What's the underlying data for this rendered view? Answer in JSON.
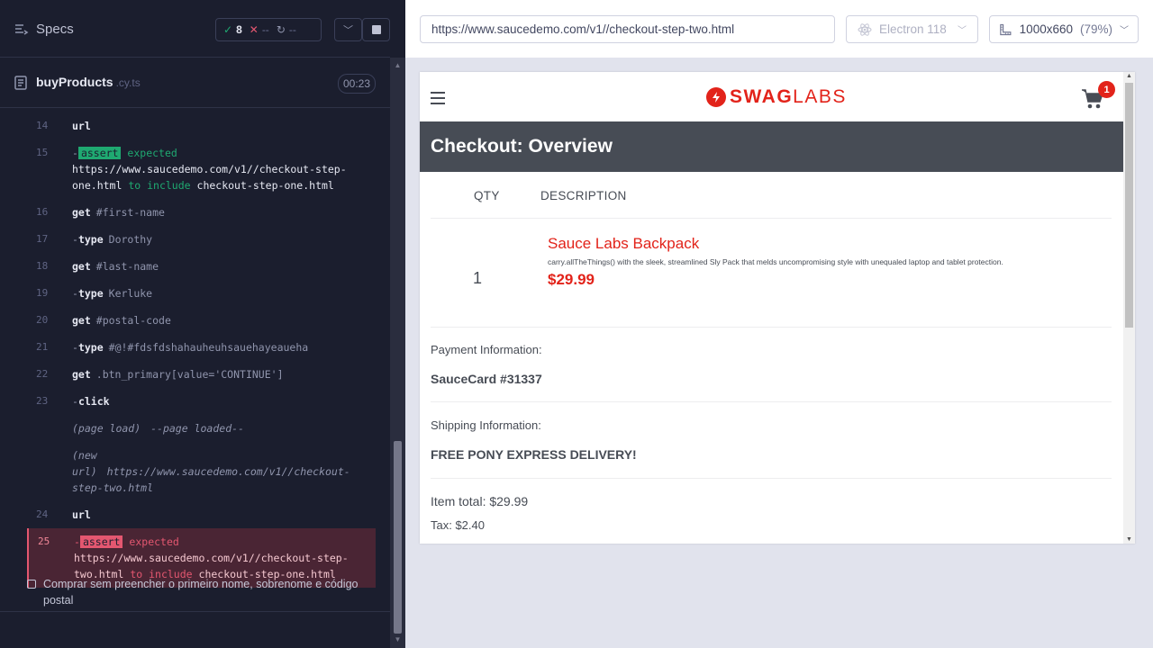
{
  "reporter": {
    "specs_label": "Specs",
    "stats": {
      "passed": "8",
      "failed": "--",
      "pending": "--"
    },
    "spec_file": {
      "name": "buyProducts",
      "ext": ".cy.ts",
      "duration": "00:23"
    },
    "commands": [
      {
        "num": "14",
        "name": "url",
        "msg": ""
      },
      {
        "num": "15",
        "type": "assert",
        "state": "pass",
        "tag": "assert",
        "expected": "expected",
        "value": "https://www.saucedemo.com/v1//checkout-step-one.html",
        "to_include": "to include",
        "target": "checkout-step-one.html"
      },
      {
        "num": "16",
        "name": "get",
        "msg": "#first-name"
      },
      {
        "num": "17",
        "name": "type",
        "msg": "Dorothy",
        "child": true
      },
      {
        "num": "18",
        "name": "get",
        "msg": "#last-name"
      },
      {
        "num": "19",
        "name": "type",
        "msg": "Kerluke",
        "child": true
      },
      {
        "num": "20",
        "name": "get",
        "msg": "#postal-code"
      },
      {
        "num": "21",
        "name": "type",
        "msg": "#@!#fdsfdshahauheuhsauehayeaueha",
        "child": true
      },
      {
        "num": "22",
        "name": "get",
        "msg": ".btn_primary[value='CONTINUE']"
      },
      {
        "num": "23",
        "name": "click",
        "msg": "",
        "child": true
      },
      {
        "event1_a": "(page load)",
        "event1_b": "--page loaded--"
      },
      {
        "event2_a": "(new",
        "event2_b": "url)",
        "event2_c": "https://www.saucedemo.com/v1//checkout-step-two.html"
      },
      {
        "num": "24",
        "name": "url",
        "msg": ""
      },
      {
        "num": "25",
        "type": "assert",
        "state": "fail",
        "tag": "assert",
        "expected": "expected",
        "value": "https://www.saucedemo.com/v1//checkout-step-two.html",
        "to_include": "to include",
        "target": "checkout-step-one.html"
      }
    ],
    "test_title": "Comprar sem preencher o primeiro nome, sobrenome e código postal"
  },
  "aut": {
    "url": "https://www.saucedemo.com/v1//checkout-step-two.html",
    "browser": "Electron 118",
    "viewport": "1000x660",
    "scale": "(79%)",
    "app": {
      "logo_bold": "SWAG",
      "logo_light": "LABS",
      "cart_count": "1",
      "title": "Checkout: Overview",
      "col_qty": "QTY",
      "col_desc": "DESCRIPTION",
      "item": {
        "qty": "1",
        "name": "Sauce Labs Backpack",
        "desc": "carry.allTheThings() with the sleek, streamlined Sly Pack that melds uncompromising style with unequaled laptop and tablet protection.",
        "price": "$29.99"
      },
      "payment_label": "Payment Information:",
      "payment_value": "SauceCard #31337",
      "shipping_label": "Shipping Information:",
      "shipping_value": "FREE PONY EXPRESS DELIVERY!",
      "item_total": "Item total: $29.99",
      "tax": "Tax: $2.40"
    }
  },
  "colors": {
    "pass": "#1fa971",
    "fail": "#e45770",
    "brand": "#e2231a",
    "header_dark": "#474c55"
  }
}
